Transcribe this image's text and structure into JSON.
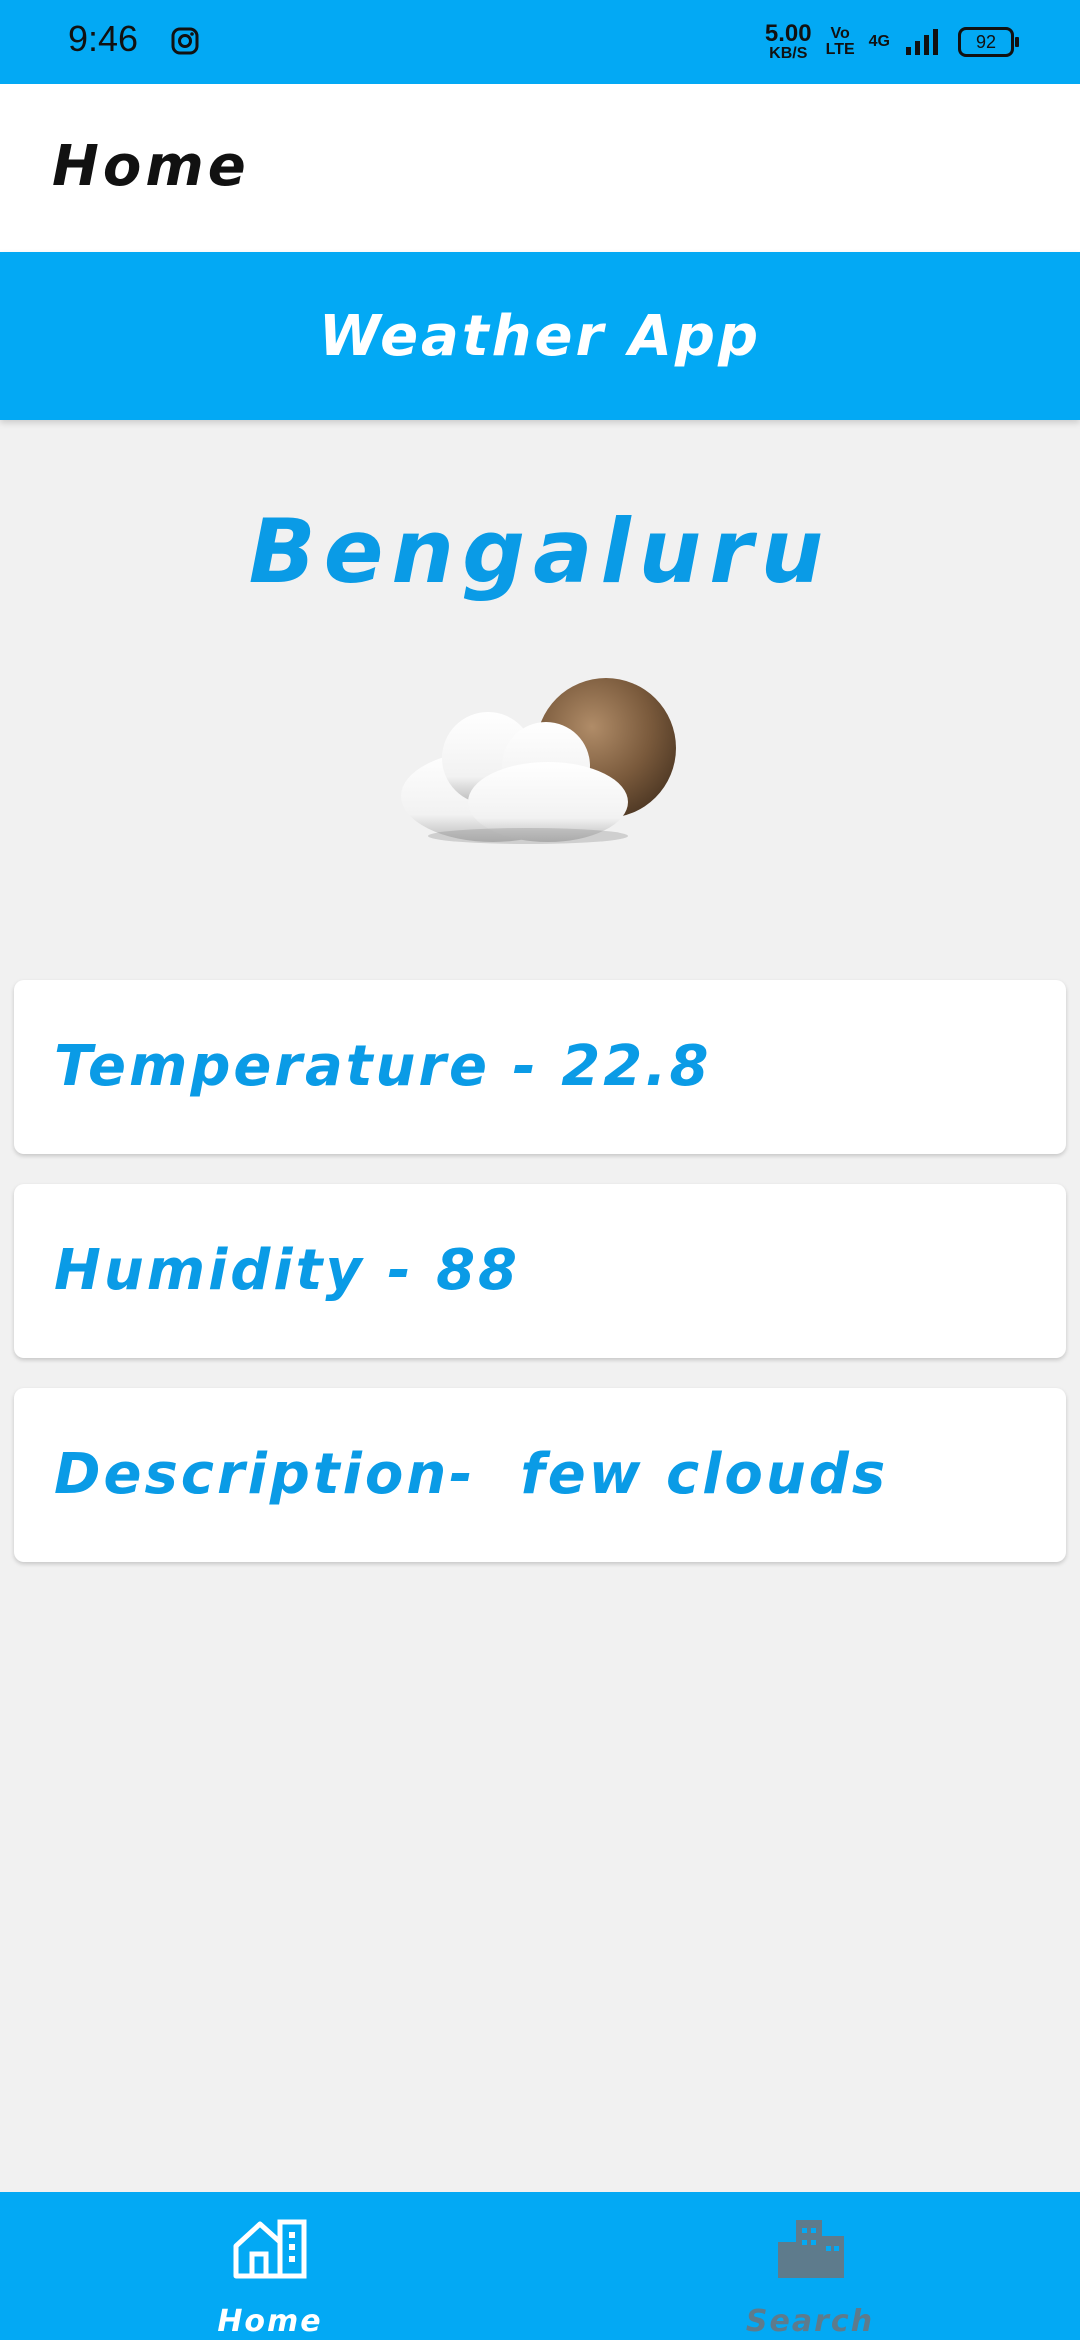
{
  "status_bar": {
    "time": "9:46",
    "speed_value": "5.00",
    "speed_unit": "KB/S",
    "volte_top": "Vo",
    "volte_bottom": "LTE",
    "network": "4G",
    "battery": "92",
    "icons": [
      "instagram-icon",
      "signal-icon",
      "battery-icon"
    ]
  },
  "app_bar": {
    "title": "Home"
  },
  "banner": {
    "title": "Weather App"
  },
  "weather": {
    "city": "Bengaluru",
    "icon": "few-clouds-icon",
    "temperature_text": "Temperature - 22.8",
    "humidity_text": "Humidity - 88",
    "description_text": "Description-  few clouds"
  },
  "bottom_nav": {
    "items": [
      {
        "label": "Home",
        "icon": "home-icon",
        "active": true
      },
      {
        "label": "Search",
        "icon": "city-icon",
        "active": false
      }
    ]
  },
  "colors": {
    "primary": "#03a9f4",
    "accent_text": "#0a9be6",
    "background": "#f1f1f1",
    "inactive_nav": "#5e7b8c"
  }
}
